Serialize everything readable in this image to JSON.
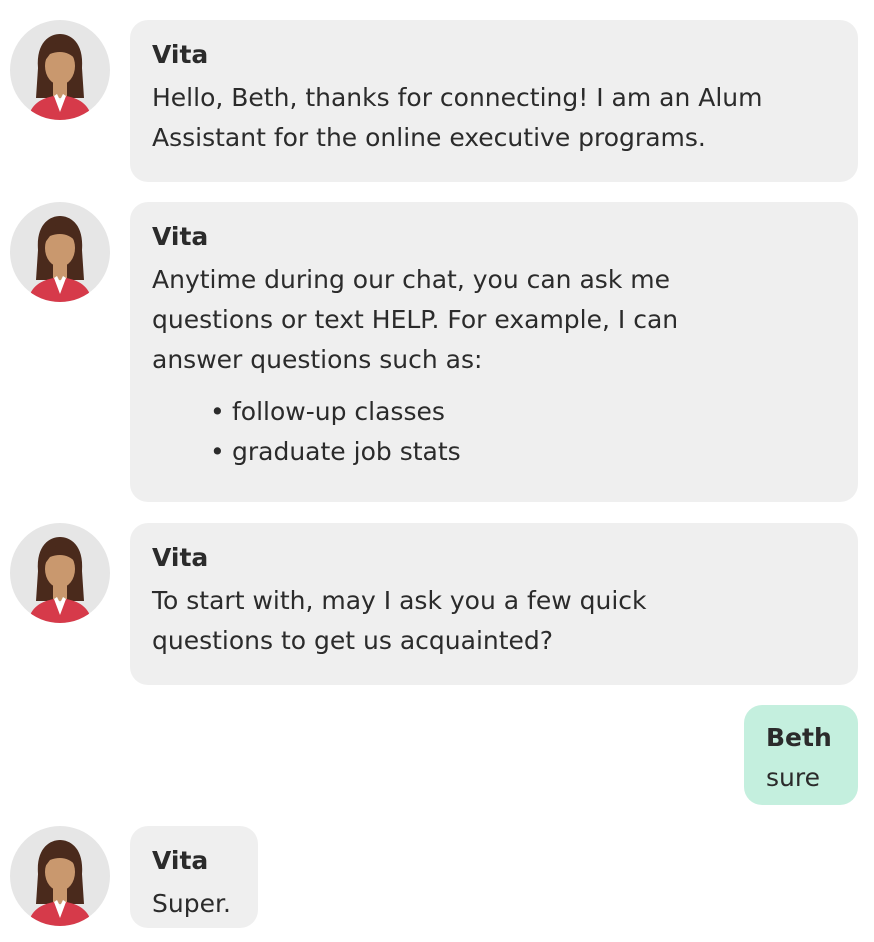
{
  "conversation": {
    "messages": [
      {
        "role": "bot",
        "sender": "Vita",
        "avatar_icon": "woman-avatar-icon",
        "lines": [
          "Hello, Beth, thanks for connecting! I am an Alum",
          "Assistant for the online executive programs."
        ]
      },
      {
        "role": "bot",
        "sender": "Vita",
        "avatar_icon": "woman-avatar-icon",
        "lines": [
          "Anytime during our chat, you can ask me",
          "questions or text HELP. For example, I can",
          "answer questions such as:"
        ],
        "bullets": [
          "follow-up classes",
          "graduate job stats"
        ]
      },
      {
        "role": "bot",
        "sender": "Vita",
        "avatar_icon": "woman-avatar-icon",
        "lines": [
          "To start with, may I ask you a few quick",
          "questions to get us acquainted?"
        ]
      },
      {
        "role": "user",
        "sender": "Beth",
        "lines": [
          "sure"
        ]
      },
      {
        "role": "bot",
        "sender": "Vita",
        "avatar_icon": "woman-avatar-icon",
        "lines": [
          "Super."
        ]
      }
    ],
    "bullet_glyph": "•"
  },
  "colors": {
    "bot_bubble": "#efefef",
    "user_bubble": "#c4efde",
    "text": "#2b2b2b",
    "avatar_bg": "#e6e6e6",
    "hair": "#4a2a1c",
    "skin": "#c9986e",
    "jacket": "#d63a4a"
  }
}
